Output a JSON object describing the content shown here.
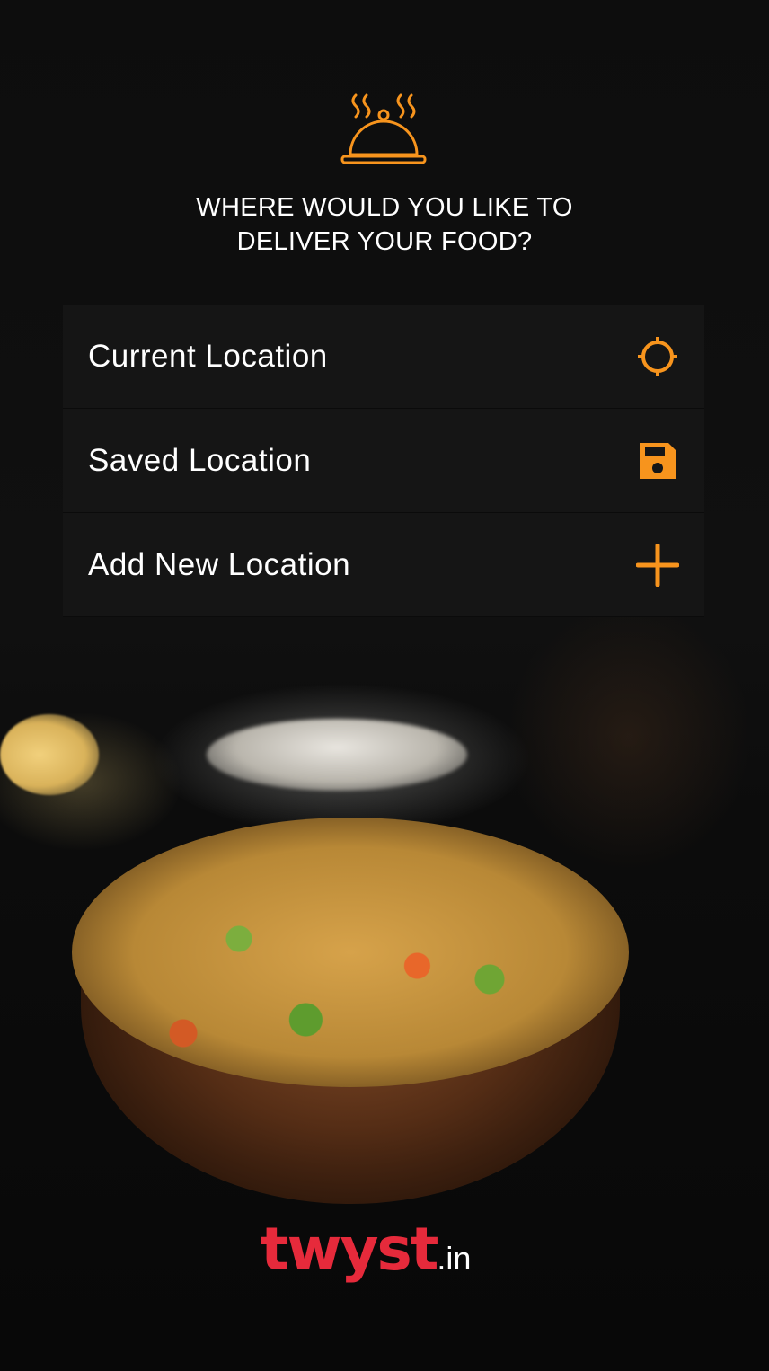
{
  "header": {
    "icon": "food-cloche-icon",
    "title_line1": "WHERE WOULD YOU LIKE TO",
    "title_line2": "DELIVER YOUR FOOD?"
  },
  "options": [
    {
      "label": "Current Location",
      "icon": "crosshair-icon"
    },
    {
      "label": "Saved Location",
      "icon": "save-icon"
    },
    {
      "label": "Add New Location",
      "icon": "plus-icon"
    }
  ],
  "brand": {
    "name": "twyst",
    "tld": ".in",
    "accent_color": "#f7941d",
    "logo_color": "#e62a3b"
  }
}
